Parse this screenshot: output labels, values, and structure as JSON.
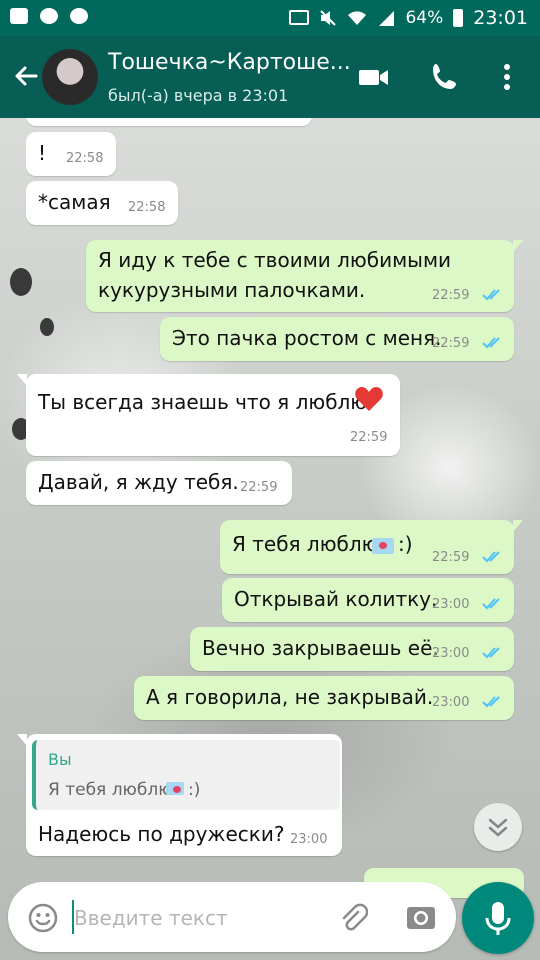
{
  "status_bar": {
    "battery": "64%",
    "time": "23:01"
  },
  "header": {
    "contact_name": "Тошечка~Картоше...",
    "last_seen": "был(-а) вчера в 23:01"
  },
  "messages": [
    {
      "text": "!",
      "time": "22:58"
    },
    {
      "text": "*самая",
      "time": "22:58"
    },
    {
      "line1": "Я иду к тебе с твоими любимыми",
      "line2": "кукурузными палочками.",
      "time": "22:59"
    },
    {
      "text": "Это пачка ростом с меня.",
      "time": "22:59"
    },
    {
      "text": "Ты всегда знаешь что я люблю.",
      "time": "22:59"
    },
    {
      "text": "Давай, я жду тебя.",
      "time": "22:59"
    },
    {
      "text_before": "Я тебя люблю",
      "text_after": ":)",
      "time": "22:59"
    },
    {
      "text": "Открывай колитку.",
      "time": "23:00"
    },
    {
      "text": "Вечно закрываешь её.",
      "time": "23:00"
    },
    {
      "text": "А я говорила, не закрывай.",
      "time": "23:00"
    },
    {
      "quote_name": "Вы",
      "quote_before": "Я тебя люблю",
      "quote_after": ":)",
      "text": "Надеюсь по дружески?",
      "time": "23:00"
    }
  ],
  "composer": {
    "placeholder": "Введите текст"
  },
  "colors": {
    "header": "#075e54",
    "status_bar": "#00695c",
    "accent": "#00897b",
    "outgoing": "#dcf8c6",
    "incoming": "#ffffff",
    "read_ticks": "#4fc3f7"
  },
  "icons": [
    "back-arrow-icon",
    "video-call-icon",
    "phone-icon",
    "more-vert-icon",
    "heart-icon",
    "envelope-heart-icon",
    "chevron-double-down-icon",
    "emoji-icon",
    "attach-icon",
    "camera-icon",
    "mic-icon"
  ]
}
